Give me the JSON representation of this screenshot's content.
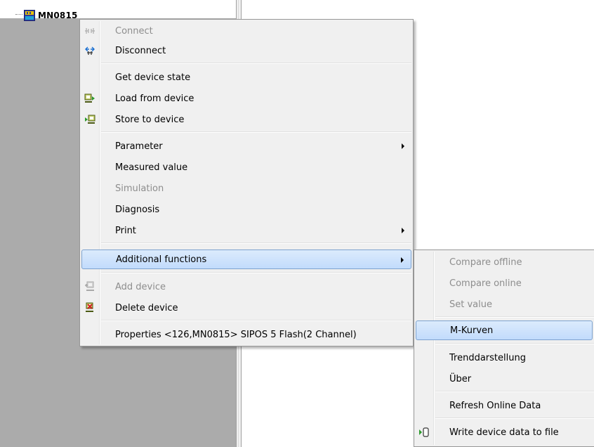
{
  "tree": {
    "node_label": "MN0815"
  },
  "context_menu": {
    "items": [
      {
        "label": "Connect",
        "enabled": false,
        "icon": "connect-icon"
      },
      {
        "label": "Disconnect",
        "enabled": true,
        "icon": "disconnect-icon"
      },
      {
        "label": "Get device state",
        "enabled": true
      },
      {
        "label": "Load from device",
        "enabled": true,
        "icon": "load-from-device-icon"
      },
      {
        "label": "Store to device",
        "enabled": true,
        "icon": "store-to-device-icon"
      },
      {
        "label": "Parameter",
        "enabled": true,
        "submenu": true
      },
      {
        "label": "Measured value",
        "enabled": true
      },
      {
        "label": "Simulation",
        "enabled": false
      },
      {
        "label": "Diagnosis",
        "enabled": true
      },
      {
        "label": "Print",
        "enabled": true,
        "submenu": true
      },
      {
        "label": "Additional functions",
        "enabled": true,
        "submenu": true,
        "highlighted": true
      },
      {
        "label": "Add device",
        "enabled": false,
        "icon": "add-device-icon"
      },
      {
        "label": "Delete device",
        "enabled": true,
        "icon": "delete-device-icon"
      },
      {
        "label": "Properties <126,MN0815> SIPOS 5 Flash(2 Channel)",
        "enabled": true
      }
    ]
  },
  "submenu": {
    "items": [
      {
        "label": "Compare offline",
        "enabled": false
      },
      {
        "label": "Compare online",
        "enabled": false
      },
      {
        "label": "Set value",
        "enabled": false
      },
      {
        "label": "M-Kurven",
        "enabled": true,
        "highlighted": true
      },
      {
        "label": "Trenddarstellung",
        "enabled": true
      },
      {
        "label": "Über",
        "enabled": true
      },
      {
        "label": "Refresh Online Data",
        "enabled": true
      },
      {
        "label": "Write device data to file",
        "enabled": true,
        "icon": "write-file-icon"
      }
    ]
  },
  "colors": {
    "highlight_border": "#7da2ce",
    "highlight_fill": "#c1dbfc",
    "menu_bg": "#f0f0f0",
    "pane_gray": "#ababab"
  }
}
